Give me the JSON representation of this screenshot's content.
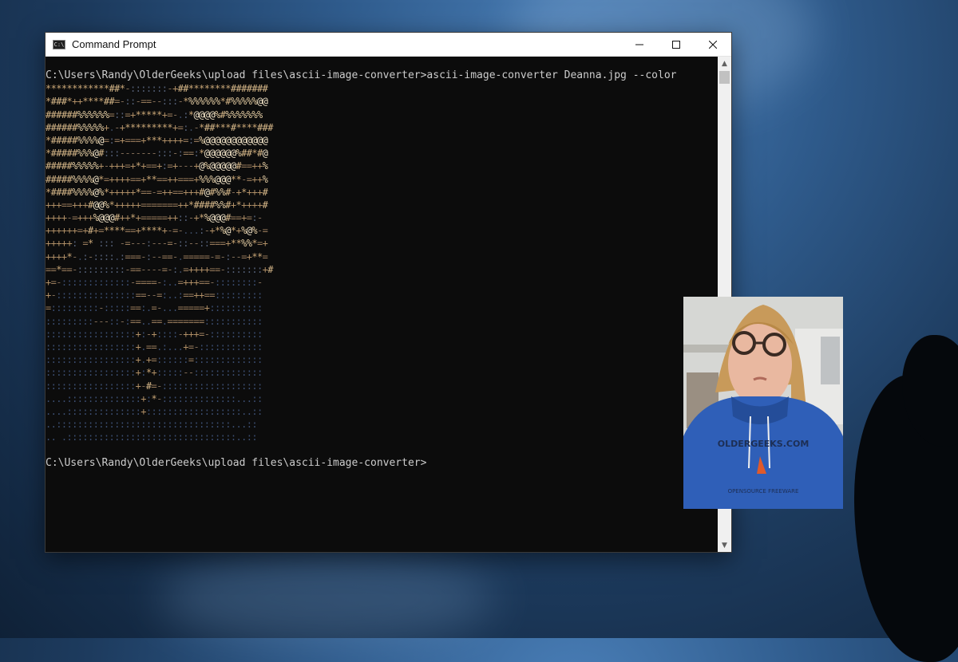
{
  "window": {
    "title": "Command Prompt",
    "icon": "cmd-icon",
    "controls": {
      "minimize": "minimize-icon",
      "maximize": "maximize-icon",
      "close": "close-icon"
    }
  },
  "console": {
    "command_line": "C:\\Users\\Randy\\OlderGeeks\\upload files\\ascii-image-converter>ascii-image-converter Deanna.jpg --color",
    "ascii_rows": [
      "************##*-:::::::-+##********#######",
      "*###*++****##=-::-==--:::-*%%%%%%*#%%%%%@@",
      "######%%%%%%=::=+*****+=-.:*@@@@%#%%%%%%%",
      "######%%%%%+.-+*********+=:.-*##***#****###",
      "*#####%%%%@=:=+===+***++++=:=%@@@@@@@@@@@@",
      "*#####%%%@#:::-------:::-:==:*@@@@@@%##*#@",
      "#####%%%%%+-+++=+*+==+:=+---+@%@@@@@#==++%",
      "#####%%%%@*=++++==+**==++===+%%%@@@**-=++%",
      "*####%%%%@%*+++++*==-=++==+++#@#%%#-+*+++#",
      "+++==+++#@@%*+++++=======++*####%%#+*++++#",
      "++++-=+++%@@@#++*+=====++::-+*%@@@#==+=:-",
      "++++++=+#+=****==+****+-=-...:-+*%@*+%@%-=",
      "+++++: =* ::: -=---:---=-::--::===+**%%*=+",
      "++++*-.:-::::.:===-:--==-.=====-=-:--=+**=",
      "==*==-:::::::::-==----=-:.=++++==-:::::::+#",
      "+=-:::::::::::::-====-:..=+++==-::::::::-",
      "+-:::::::::::::::==--=:..:==++==:::::::::",
      "=:::::::::-:::::==:.=-...=====+::::::::::",
      ":::::::::---::-:==..==.=======:::::::::::",
      ":::::::::::::::::+:-+::::-+++=-::::::::::",
      ":::::::::::::::::+.==.:...+=-::::::::::::",
      ":::::::::::::::::+.+=::::::=:::::::::::::",
      ":::::::::::::::::+:*+:::::--:::::::::::::",
      ":::::::::::::::::+-#=-:::::::::::::::::::",
      "....::::::::::::::+:*-::::::::::::::...::",
      "....::::::::::::::+::::::::::::::::::..::",
      "..:::::::::::::::::::::::::::::::::...::",
      ".. .::::::::::::::::::::::::::::::::..::"
    ],
    "prompt_line": "C:\\Users\\Randy\\OlderGeeks\\upload files\\ascii-image-converter>"
  },
  "photo": {
    "hoodie_text": "OLDERGEEKS.COM",
    "hoodie_subtext": "OPENSOURCE FREEWARE",
    "colors": {
      "hoodie": "#2f5fb8",
      "hair": "#c89a5a",
      "skin": "#e9b8a0"
    }
  },
  "colors": {
    "console_bg": "#0c0c0c",
    "console_text": "#cccccc",
    "desktop_sky": "#2f5b8c"
  }
}
